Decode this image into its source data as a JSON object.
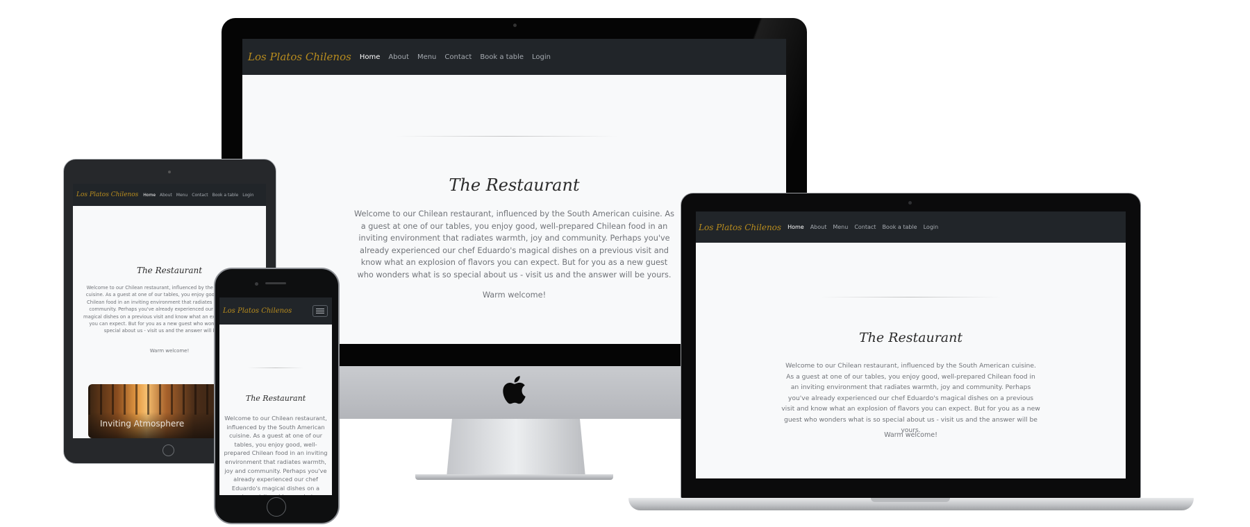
{
  "site": {
    "logo": "Los Platos Chilenos",
    "nav": [
      {
        "label": "Home",
        "active": true
      },
      {
        "label": "About",
        "active": false
      },
      {
        "label": "Menu",
        "active": false
      },
      {
        "label": "Contact",
        "active": false
      },
      {
        "label": "Book a table",
        "active": false
      },
      {
        "label": "Login",
        "active": false
      }
    ],
    "title": "The Restaurant",
    "intro": "Welcome to our Chilean restaurant, influenced by the South American cuisine. As a guest at one of our tables, you enjoy good, well-prepared Chilean food in an inviting environment that radiates warmth, joy and community. Perhaps you've already experienced our chef Eduardo's magical dishes on a previous visit and know what an explosion of flavors you can expect. But for you as a new guest who wonders what is so special about us - visit us and the answer will be yours.",
    "welcome": "Warm welcome!",
    "card_caption": "Inviting Atmosphere"
  },
  "colors": {
    "navbar_bg": "#212529",
    "page_bg": "#f8f9fa",
    "logo": "#b88c1e",
    "nav_link": "#a6abb1",
    "nav_active": "#ffffff",
    "text": "#707378"
  },
  "icons": {
    "apple": "apple-logo-icon",
    "menu": "hamburger-menu-icon"
  }
}
